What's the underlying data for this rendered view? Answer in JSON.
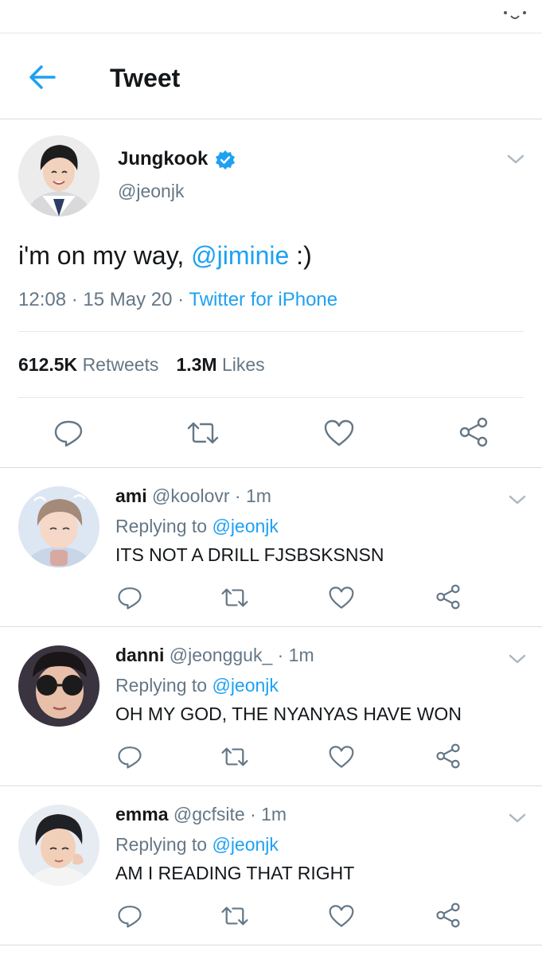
{
  "colors": {
    "accent": "#1da1f2",
    "secondary_text": "#657786",
    "primary_text": "#14171a",
    "divider": "#e1e8ed"
  },
  "header": {
    "title": "Tweet",
    "back_icon": "arrow-left-icon"
  },
  "tweet": {
    "name": "Jungkook",
    "handle": "@jeonjk",
    "text_before": "i'm on my way, ",
    "mention": "@jiminie",
    "text_after": " :)",
    "time": "12:08 · 15 May 20 · ",
    "source": "Twitter for iPhone",
    "retweets_count": "612.5K",
    "retweets_label": "Retweets",
    "likes_count": "1.3M",
    "likes_label": "Likes"
  },
  "replies": [
    {
      "name": "ami",
      "meta": "@koolovr · 1m",
      "replying_label": "Replying to ",
      "replying_to": "@jeonjk",
      "text": "ITS NOT A DRILL FJSBSKSNSN"
    },
    {
      "name": "danni",
      "meta": "@jeongguk_ · 1m",
      "replying_label": "Replying to ",
      "replying_to": "@jeonjk",
      "text": "OH MY GOD, THE NYANYAS HAVE WON"
    },
    {
      "name": "emma",
      "meta": "@gcfsite · 1m",
      "replying_label": "Replying to ",
      "replying_to": "@jeonjk",
      "text": "AM I READING THAT RIGHT"
    }
  ]
}
